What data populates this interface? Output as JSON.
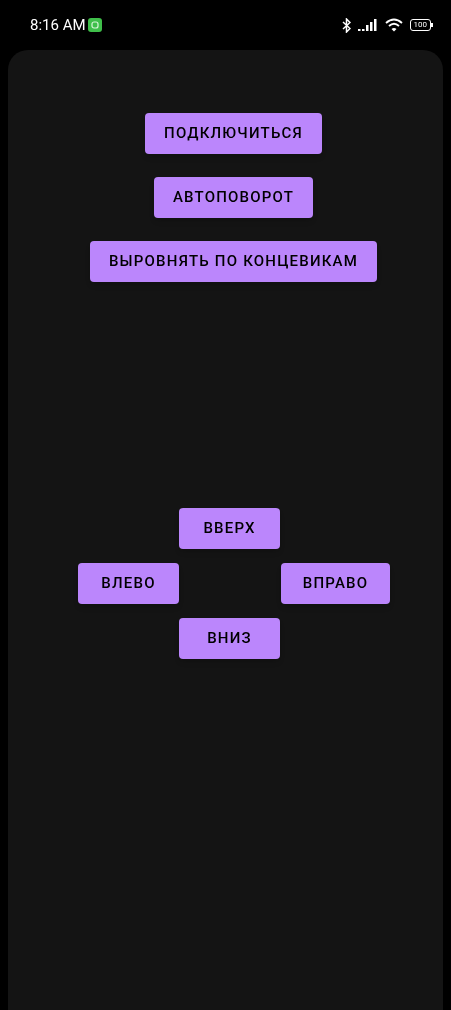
{
  "status_bar": {
    "time": "8:16 AM",
    "battery": "100"
  },
  "buttons": [
    {
      "label": "ПОДКЛЮЧИТЬСЯ"
    },
    {
      "label": "АВТОПОВОРОТ"
    },
    {
      "label": "ВЫРОВНЯТЬ ПО КОНЦЕВИКАМ"
    }
  ],
  "direction_pad": {
    "up": "ВВЕРХ",
    "left": "ВЛЕВО",
    "right": "ВПРАВО",
    "down": "ВНИЗ"
  }
}
